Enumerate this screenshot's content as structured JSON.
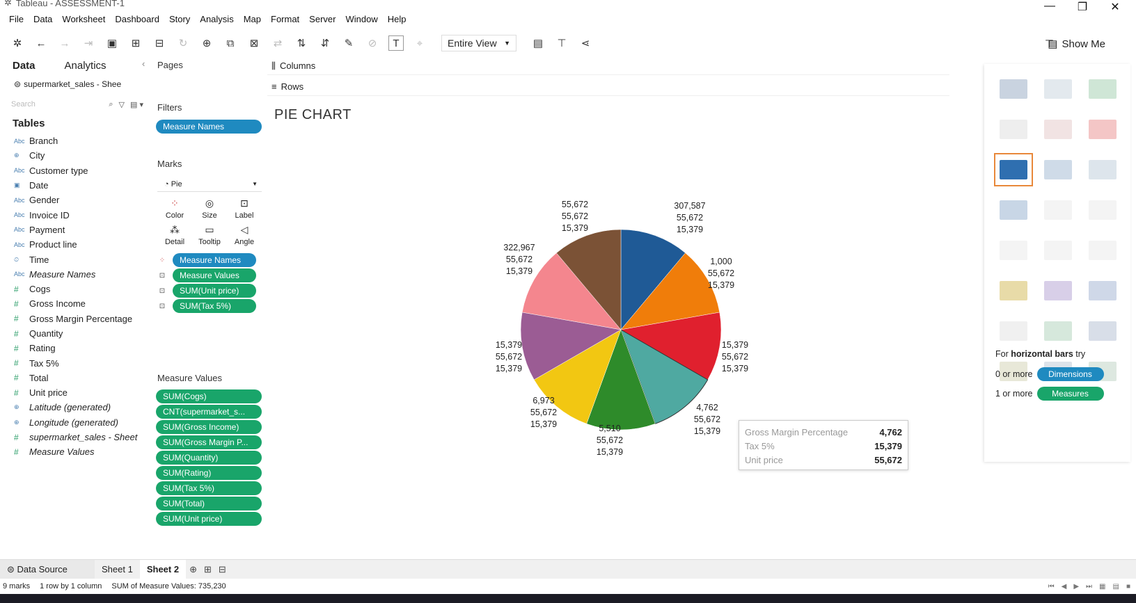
{
  "window": {
    "title": "Tableau - ASSESSMENT-1"
  },
  "menu": [
    "File",
    "Data",
    "Worksheet",
    "Dashboard",
    "Story",
    "Analysis",
    "Map",
    "Format",
    "Server",
    "Window",
    "Help"
  ],
  "toolbar": {
    "view_select": "Entire View",
    "show_me": "Show Me"
  },
  "data_pane": {
    "tabs": [
      "Data",
      "Analytics"
    ],
    "source": "supermarket_sales - Shee",
    "search_placeholder": "Search",
    "tables_header": "Tables",
    "fields": [
      {
        "icon": "Abc",
        "name": "Branch"
      },
      {
        "icon": "⊕",
        "name": "City"
      },
      {
        "icon": "Abc",
        "name": "Customer type"
      },
      {
        "icon": "▣",
        "name": "Date"
      },
      {
        "icon": "Abc",
        "name": "Gender"
      },
      {
        "icon": "Abc",
        "name": "Invoice ID"
      },
      {
        "icon": "Abc",
        "name": "Payment"
      },
      {
        "icon": "Abc",
        "name": "Product line"
      },
      {
        "icon": "⏲",
        "name": "Time"
      },
      {
        "icon": "Abc",
        "name": "Measure Names"
      },
      {
        "icon": "#",
        "name": "Cogs"
      },
      {
        "icon": "#",
        "name": "Gross Income"
      },
      {
        "icon": "#",
        "name": "Gross Margin Percentage"
      },
      {
        "icon": "#",
        "name": "Quantity"
      },
      {
        "icon": "#",
        "name": "Rating"
      },
      {
        "icon": "#",
        "name": "Tax 5%"
      },
      {
        "icon": "#",
        "name": "Total"
      },
      {
        "icon": "#",
        "name": "Unit price"
      },
      {
        "icon": "⊕",
        "name": "Latitude (generated)"
      },
      {
        "icon": "⊕",
        "name": "Longitude (generated)"
      },
      {
        "icon": "#",
        "name": "supermarket_sales - Sheet"
      },
      {
        "icon": "#",
        "name": "Measure Values"
      }
    ]
  },
  "shelves": {
    "pages_label": "Pages",
    "filters_label": "Filters",
    "filter_pill": "Measure Names",
    "marks_label": "Marks",
    "mark_type": "Pie",
    "mark_buttons": [
      "Color",
      "Size",
      "Label",
      "Detail",
      "Tooltip",
      "Angle"
    ],
    "mark_pills": [
      "Measure Names",
      "Measure Values",
      "SUM(Unit price)",
      "SUM(Tax 5%)"
    ],
    "measure_values_label": "Measure Values",
    "measure_values_pills": [
      "SUM(Cogs)",
      "CNT(supermarket_s...",
      "SUM(Gross Income)",
      "SUM(Gross Margin P...",
      "SUM(Quantity)",
      "SUM(Rating)",
      "SUM(Tax 5%)",
      "SUM(Total)",
      "SUM(Unit price)"
    ],
    "columns_label": "Columns",
    "rows_label": "Rows"
  },
  "chart_data": {
    "type": "pie",
    "title": "PIE CHART",
    "slices": [
      {
        "value": 307587,
        "color": "#1f5a96",
        "label": [
          "307,587",
          "55,672",
          "15,379"
        ]
      },
      {
        "value": 1000,
        "color": "#f07d0a",
        "label": [
          "1,000",
          "55,672",
          "15,379"
        ]
      },
      {
        "value": 15379,
        "color": "#e0202e",
        "label": [
          "15,379",
          "55,672",
          "15,379"
        ]
      },
      {
        "value": 4762,
        "color": "#4fa9a1",
        "label": [
          "4,762",
          "55,672",
          "15,379"
        ]
      },
      {
        "value": 5510,
        "color": "#2e8b2a",
        "label": [
          "5,510",
          "55,672",
          "15,379"
        ]
      },
      {
        "value": 6973,
        "color": "#f2c712",
        "label": [
          "6,973",
          "55,672",
          "15,379"
        ]
      },
      {
        "value": 15379,
        "color": "#9b5c94",
        "label": [
          "15,379",
          "55,672",
          "15,379"
        ]
      },
      {
        "value": 322967,
        "color": "#f4868e",
        "label": [
          "322,967",
          "55,672",
          "15,379"
        ]
      },
      {
        "value": 55672,
        "color": "#7b5236",
        "label": [
          "55,672",
          "55,672",
          "15,379"
        ]
      }
    ]
  },
  "tooltip": [
    {
      "k": "Gross Margin Percentage",
      "v": "4,762"
    },
    {
      "k": "Tax 5%",
      "v": "15,379"
    },
    {
      "k": "Unit price",
      "v": "55,672"
    }
  ],
  "show_me": {
    "hint_prefix": "For ",
    "hint_bold": "horizontal bars",
    "hint_suffix": " try",
    "dims_prefix": "0 or more",
    "dims_pill": "Dimensions",
    "meas_prefix": "1 or more",
    "meas_pill": "Measures",
    "thumb_colors": [
      "#c9d3e0",
      "#e3e9ee",
      "#cfe6d6",
      "#eeeeee",
      "#f1e3e3",
      "#f4c6c6",
      "#2f6fb0",
      "#cfdbe8",
      "#dde5ec",
      "#c8d6e6",
      "#f4f4f4",
      "#f4f4f4",
      "#f4f4f4",
      "#f4f4f4",
      "#f4f4f4",
      "#e8dba8",
      "#d8cfe8",
      "#cfd8e8",
      "#f0f0f0",
      "#d6e8dc",
      "#d8dee8",
      "#e8e8d8",
      "#dde3ea",
      "#dde8e0"
    ]
  },
  "sheet_tabs": {
    "data_source": "Data Source",
    "sheets": [
      "Sheet 1",
      "Sheet 2"
    ]
  },
  "status": {
    "marks": "9 marks",
    "dims": "1 row by 1 column",
    "sum": "SUM of Measure Values: 735,230"
  }
}
